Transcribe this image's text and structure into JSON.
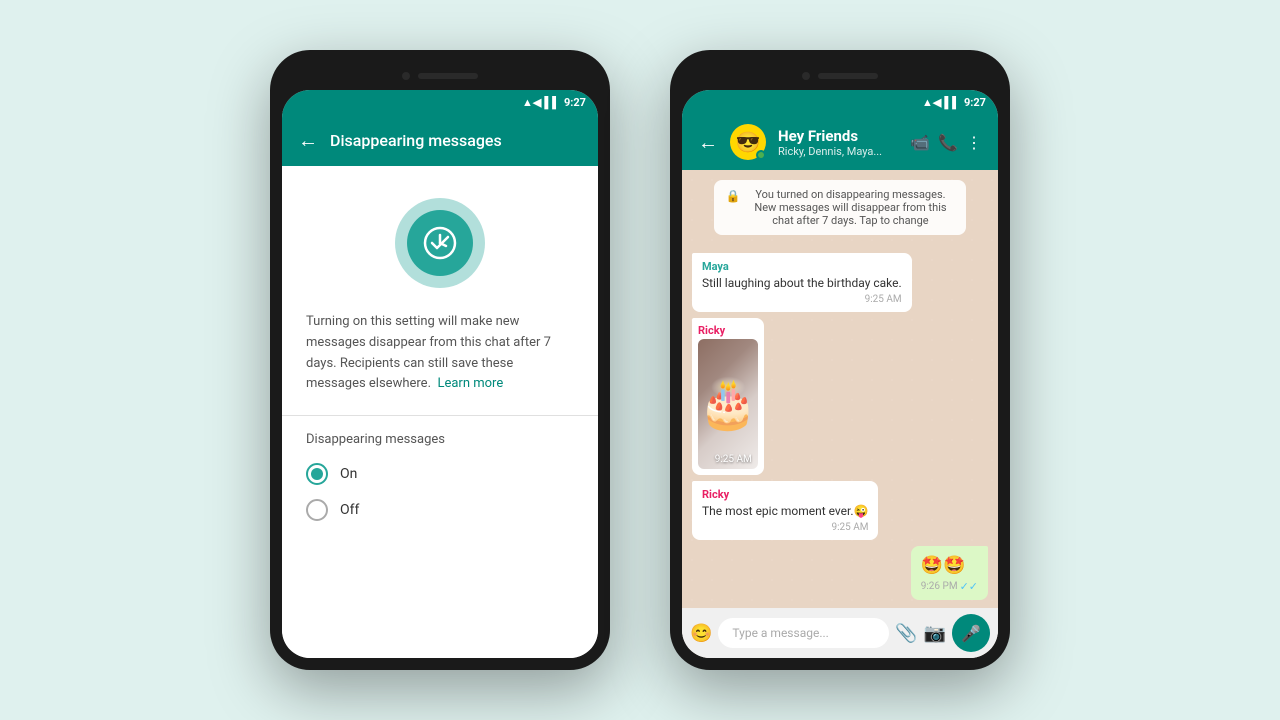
{
  "background_color": "#dff1ee",
  "phone1": {
    "status_bar": {
      "time": "9:27",
      "signal": "▲◀",
      "wifi": "▲"
    },
    "app_bar": {
      "back_arrow": "←",
      "title": "Disappearing messages"
    },
    "icon": {
      "emoji": "✓"
    },
    "description": "Turning on this setting will make new messages disappear from this chat after 7 days. Recipients can still save these messages elsewhere.",
    "learn_more": "Learn more",
    "section_label": "Disappearing messages",
    "options": [
      {
        "label": "On",
        "selected": true
      },
      {
        "label": "Off",
        "selected": false
      }
    ]
  },
  "phone2": {
    "status_bar": {
      "time": "9:27"
    },
    "app_bar": {
      "back_arrow": "←",
      "group_name": "Hey Friends",
      "group_subtitle": "Ricky, Dennis, Maya...",
      "avatar_emoji": "😎",
      "actions": [
        "📹",
        "📞",
        "⋮"
      ]
    },
    "system_notification": "You turned on disappearing messages. New messages will disappear from this chat after 7 days. Tap to change",
    "messages": [
      {
        "sender": "Maya",
        "sender_color": "teal",
        "text": "Still laughing about the birthday cake.",
        "time": "9:25 AM",
        "type": "received"
      },
      {
        "sender": "Ricky",
        "sender_color": "pink",
        "text": "The most epic moment ever.😜",
        "time": "9:25 AM",
        "type": "received",
        "has_image": true,
        "image_time": "9:25 AM"
      },
      {
        "text": "🤩🤩",
        "time": "9:26 PM",
        "type": "sent",
        "tick": "✓✓"
      }
    ],
    "input": {
      "placeholder": "Type a message..."
    }
  }
}
